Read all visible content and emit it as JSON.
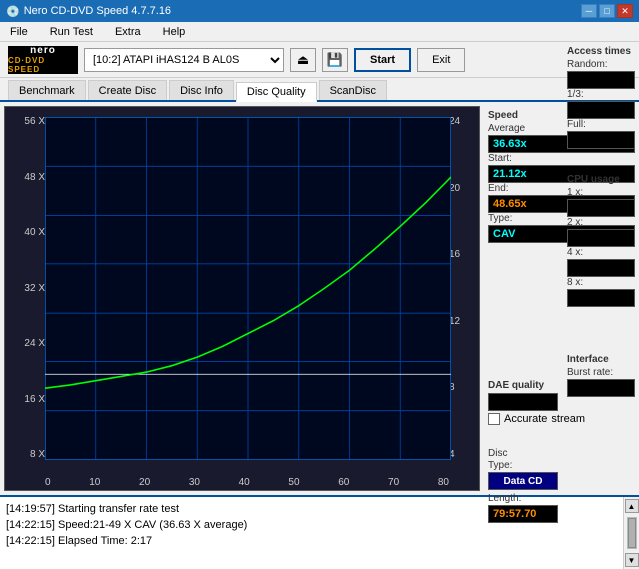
{
  "titlebar": {
    "title": "Nero CD-DVD Speed 4.7.7.16",
    "min_label": "─",
    "max_label": "□",
    "close_label": "✕"
  },
  "menubar": {
    "items": [
      "File",
      "Run Test",
      "Extra",
      "Help"
    ]
  },
  "toolbar": {
    "drive_value": "[10:2]  ATAPI iHAS124  B AL0S",
    "start_label": "Start",
    "exit_label": "Exit"
  },
  "tabs": {
    "items": [
      "Benchmark",
      "Create Disc",
      "Disc Info",
      "Disc Quality",
      "ScanDisc"
    ],
    "active": "Disc Quality"
  },
  "chart": {
    "y_left": [
      "56 X",
      "48 X",
      "40 X",
      "32 X",
      "24 X",
      "16 X",
      "8 X"
    ],
    "y_right": [
      "24",
      "20",
      "16",
      "12",
      "8",
      "4"
    ],
    "x_labels": [
      "0",
      "10",
      "20",
      "30",
      "40",
      "50",
      "60",
      "70",
      "80"
    ]
  },
  "speed_panel": {
    "title": "Speed",
    "average_label": "Average",
    "average_value": "36.63x",
    "start_label": "Start:",
    "start_value": "21.12x",
    "end_label": "End:",
    "end_value": "48.65x",
    "type_label": "Type:",
    "type_value": "CAV"
  },
  "access_panel": {
    "title": "Access times",
    "random_label": "Random:",
    "random_value": "",
    "one_third_label": "1/3:",
    "one_third_value": "",
    "full_label": "Full:",
    "full_value": ""
  },
  "dae_panel": {
    "title": "DAE quality",
    "value": "",
    "accurate_label": "Accurate",
    "stream_label": "stream"
  },
  "cpu_panel": {
    "title": "CPU usage",
    "one_x_label": "1 x:",
    "one_x_value": "",
    "two_x_label": "2 x:",
    "two_x_value": "",
    "four_x_label": "4 x:",
    "four_x_value": "",
    "eight_x_label": "8 x:",
    "eight_x_value": ""
  },
  "disc_panel": {
    "type_label": "Disc",
    "type_sub": "Type:",
    "type_value": "Data CD",
    "length_label": "Length:",
    "length_value": "79:57.70"
  },
  "interface_panel": {
    "title": "Interface",
    "burst_label": "Burst rate:",
    "burst_value": ""
  },
  "log": {
    "lines": [
      "[14:19:57]  Starting transfer rate test",
      "[14:22:15]  Speed:21-49 X CAV (36.63 X average)",
      "[14:22:15]  Elapsed Time: 2:17"
    ]
  }
}
